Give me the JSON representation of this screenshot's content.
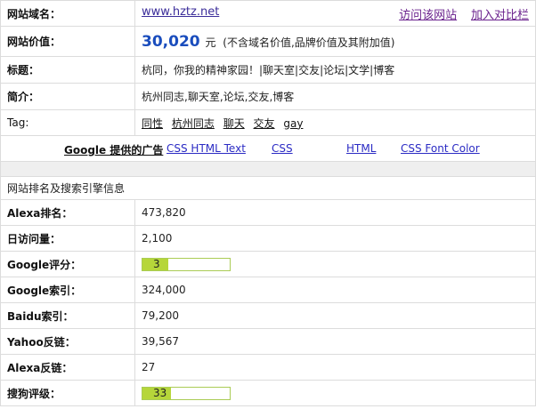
{
  "top": {
    "domain": {
      "label": "网站域名：",
      "value": "www.hztz.net",
      "visit_link": "访问该网站",
      "compare_link": "加入对比栏"
    },
    "value_row": {
      "label": "网站价值：",
      "amount": "30,020",
      "unit": "元",
      "note": "(不含域名价值,品牌价值及其附加值)"
    },
    "title_row": {
      "label": "标题：",
      "value": "杭同，你我的精神家园！|聊天室|交友|论坛|文学|博客"
    },
    "intro_row": {
      "label": "简介：",
      "value": "杭州同志,聊天室,论坛,交友,博客"
    },
    "tag_row": {
      "label": "Tag:",
      "tags": [
        "同性",
        "杭州同志",
        "聊天",
        "交友",
        "gay"
      ]
    }
  },
  "ads": {
    "title": "Google 提供的广告",
    "links": [
      "CSS HTML Text",
      "CSS",
      "HTML",
      "CSS Font Color"
    ]
  },
  "ranking": {
    "section_title": "网站排名及搜索引擎信息",
    "rows": [
      {
        "label": "Alexa排名：",
        "value": "473,820"
      },
      {
        "label": "日访问量：",
        "value": "2,100"
      },
      {
        "label": "Google评分：",
        "value": "3",
        "fill_fraction": 0.3
      },
      {
        "label": "Google索引：",
        "value": "324,000"
      },
      {
        "label": "Baidu索引：",
        "value": "79,200"
      },
      {
        "label": "Yahoo反链：",
        "value": "39,567"
      },
      {
        "label": "Alexa反链：",
        "value": "27"
      },
      {
        "label": "搜狗评级：",
        "value": "33",
        "fill_fraction": 0.33
      }
    ]
  },
  "colors": {
    "accent_price": "#1a4dbd",
    "bar_fill": "#b6d63a",
    "link": "#3b2d9a"
  }
}
